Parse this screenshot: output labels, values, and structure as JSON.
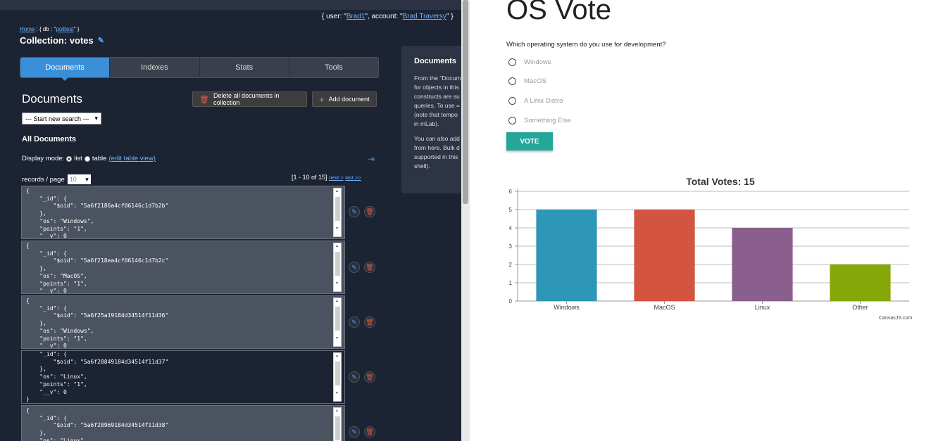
{
  "left_panel": {
    "user_info": {
      "prefix": "{ user: \"",
      "user": "Brad1",
      "mid": "\", account: \"",
      "account": "Brad Traversy",
      "suffix": "\" }"
    },
    "breadcrumb": {
      "home": "Home",
      "db_prefix": " : { db : \"",
      "db": "polltest",
      "db_suffix": "\" }"
    },
    "collection_title": "Collection: votes",
    "tabs": [
      "Documents",
      "Indexes",
      "Stats",
      "Tools"
    ],
    "heading": "Documents",
    "delete_all_label": "Delete all documents in collection",
    "add_document_label": "Add document",
    "search_select": "--- Start new search ---",
    "all_documents": "All Documents",
    "display_mode": {
      "label": "Display mode:",
      "list": "list",
      "table": "table",
      "edit_table_view": "(edit table view)"
    },
    "records_per_page": {
      "label": "records / page",
      "value": "10"
    },
    "range": {
      "text": "[1 - 10 of 15]",
      "next": "next >",
      "last": "last >>"
    },
    "documents": [
      "{\n    \"_id\": {\n        \"$oid\": \"5a6f2186a4cf06146c1d7b2b\"\n    },\n    \"os\": \"Windows\",\n    \"points\": \"1\",\n    \"__v\": 0",
      "{\n    \"_id\": {\n        \"$oid\": \"5a6f218ea4cf06146c1d7b2c\"\n    },\n    \"os\": \"MacOS\",\n    \"points\": \"1\",\n    \"__v\": 0",
      "{\n    \"_id\": {\n        \"$oid\": \"5a6f25a19184d34514f11d36\"\n    },\n    \"os\": \"Windows\",\n    \"points\": \"1\",\n    \"__v\": 0",
      "    \"_id\": {\n        \"$oid\": \"5a6f28849184d34514f11d37\"\n    },\n    \"os\": \"Linux\",\n    \"points\": \"1\",\n    \"__v\": 0\n}",
      "{\n    \"_id\": {\n        \"$oid\": \"5a6f28969184d34514f11d38\"\n    },\n    \"os\": \"Linux\","
    ],
    "info_panel": {
      "title": "Documents",
      "para1_lines": [
        "From the \"Docum",
        "for objects in this",
        "constructs are su",
        "queries. To use =",
        "(note that tempo",
        "in mLab)."
      ],
      "para2_lines": [
        "You can also add",
        "from here. Bulk d",
        "supported in this",
        "shell)."
      ]
    }
  },
  "right_panel": {
    "title": "OS Vote",
    "question": "Which operating system do you use for development?",
    "options": [
      "Windows",
      "MacOS",
      "A Linix Distro",
      "Something Else"
    ],
    "vote_label": "VOTE",
    "credit": "CanvasJS.com"
  },
  "chart_data": {
    "type": "bar",
    "title": "Total Votes: 15",
    "categories": [
      "Windows",
      "MacOS",
      "Linux",
      "Other"
    ],
    "values": [
      5,
      5,
      4,
      2
    ],
    "colors": [
      "#2e96b6",
      "#d35441",
      "#8a5f8d",
      "#86a708"
    ],
    "ylim": [
      0,
      6
    ],
    "yticks": [
      0,
      1,
      2,
      3,
      4,
      5,
      6
    ],
    "grid": true
  }
}
